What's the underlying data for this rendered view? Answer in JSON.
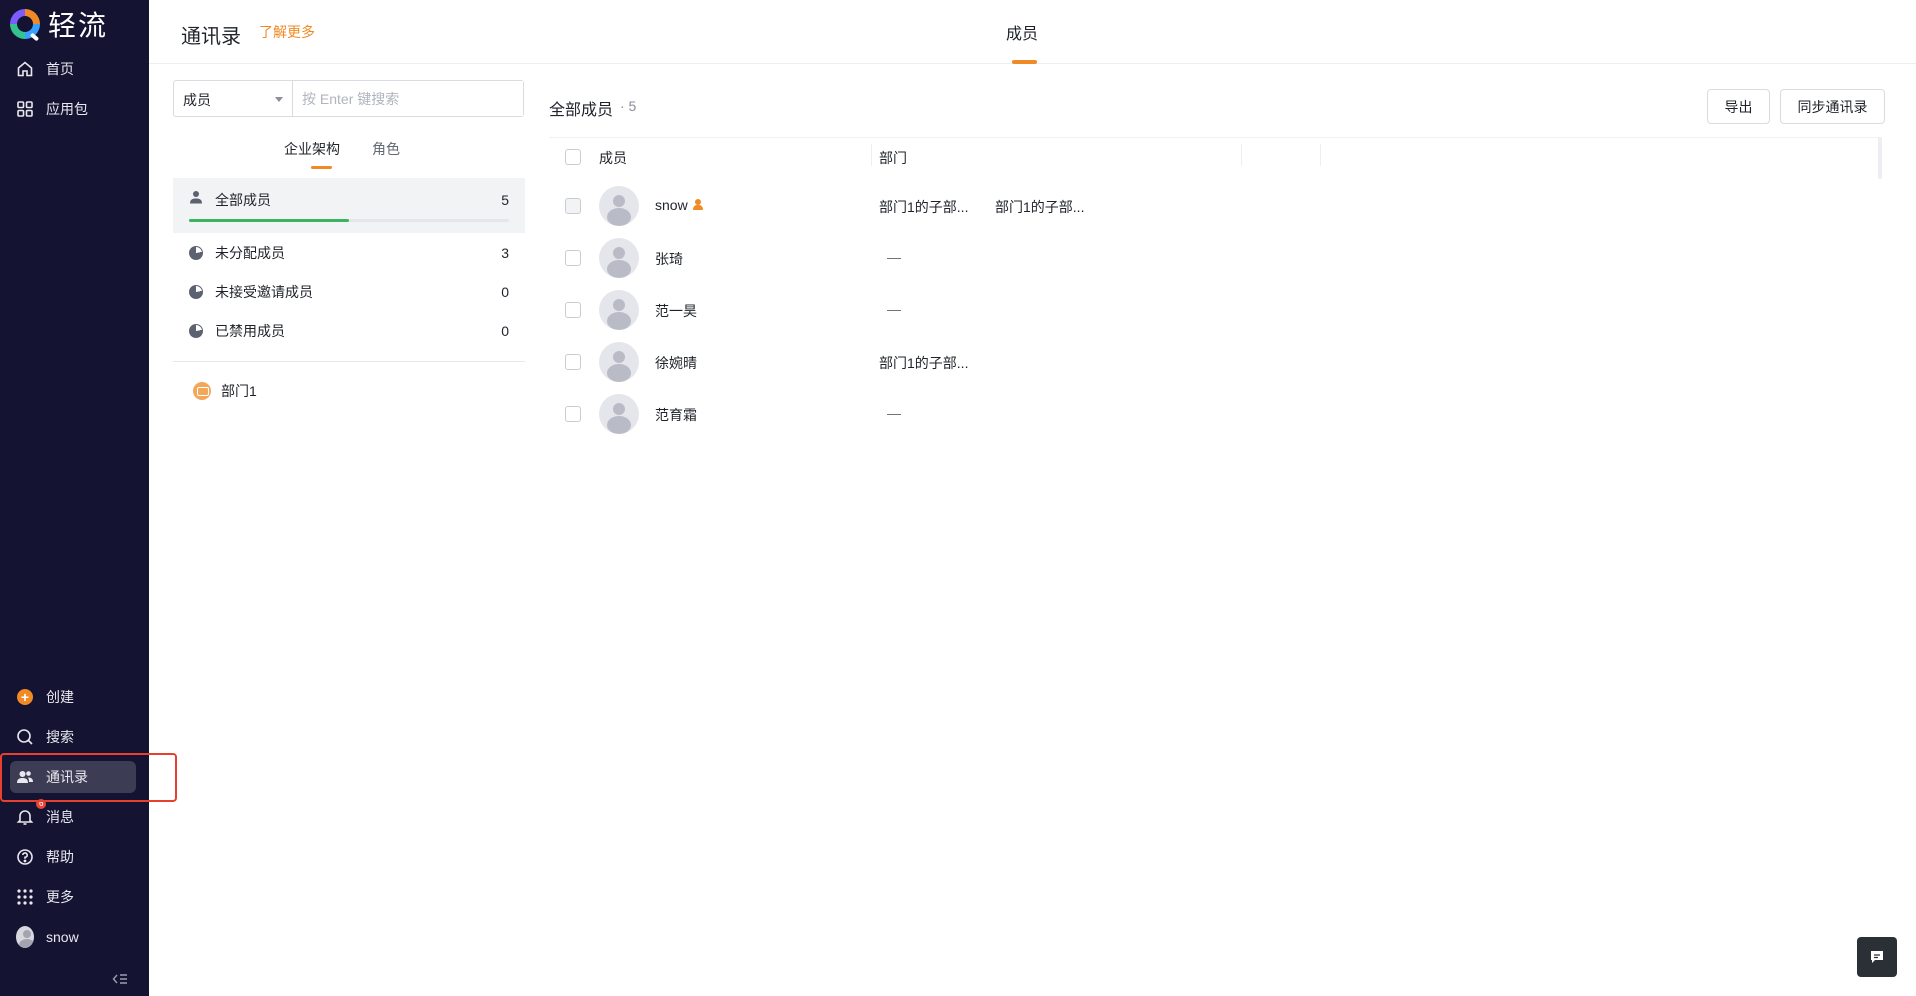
{
  "app": {
    "logo_text": "轻流"
  },
  "sidebar": {
    "top_items": [
      {
        "label": "首页",
        "icon": "home-icon"
      },
      {
        "label": "应用包",
        "icon": "grid-icon"
      }
    ],
    "bottom_items": [
      {
        "label": "创建",
        "icon": "plus-icon"
      },
      {
        "label": "搜索",
        "icon": "search-icon"
      },
      {
        "label": "通讯录",
        "icon": "contacts-icon",
        "active": true
      },
      {
        "label": "消息",
        "icon": "bell-icon",
        "badge": "6"
      },
      {
        "label": "帮助",
        "icon": "help-icon"
      },
      {
        "label": "更多",
        "icon": "apps-icon"
      },
      {
        "label": "snow",
        "icon": "avatar"
      }
    ],
    "collapse_icon": "collapse-icon"
  },
  "header": {
    "title": "通讯录",
    "learn_more": "了解更多",
    "tab": "成员"
  },
  "filter": {
    "select_value": "成员",
    "search_placeholder": "按 Enter 键搜索"
  },
  "sub_tabs": [
    "企业架构",
    "角色"
  ],
  "groups": [
    {
      "label": "全部成员",
      "count": "5",
      "progress": 0.5
    },
    {
      "label": "未分配成员",
      "count": "3"
    },
    {
      "label": "未接受邀请成员",
      "count": "0"
    },
    {
      "label": "已禁用成员",
      "count": "0"
    }
  ],
  "departments": [
    "部门1"
  ],
  "list": {
    "title": "全部成员",
    "count": "· 5",
    "export_label": "导出",
    "sync_label": "同步通讯录",
    "columns": [
      "成员",
      "部门"
    ],
    "rows": [
      {
        "name": "snow",
        "admin": true,
        "dept1": "部门1的子部...",
        "dept2": "部门1的子部..."
      },
      {
        "name": "张琦",
        "dash": "—"
      },
      {
        "name": "范一昊",
        "dash": "—"
      },
      {
        "name": "徐婉晴",
        "dept1": "部门1的子部..."
      },
      {
        "name": "范育霜",
        "dash": "—"
      }
    ]
  },
  "colors": {
    "accent": "#f08a24",
    "sidebar_bg": "#141432",
    "progress": "#3cb362",
    "highlight": "#e8402f"
  }
}
